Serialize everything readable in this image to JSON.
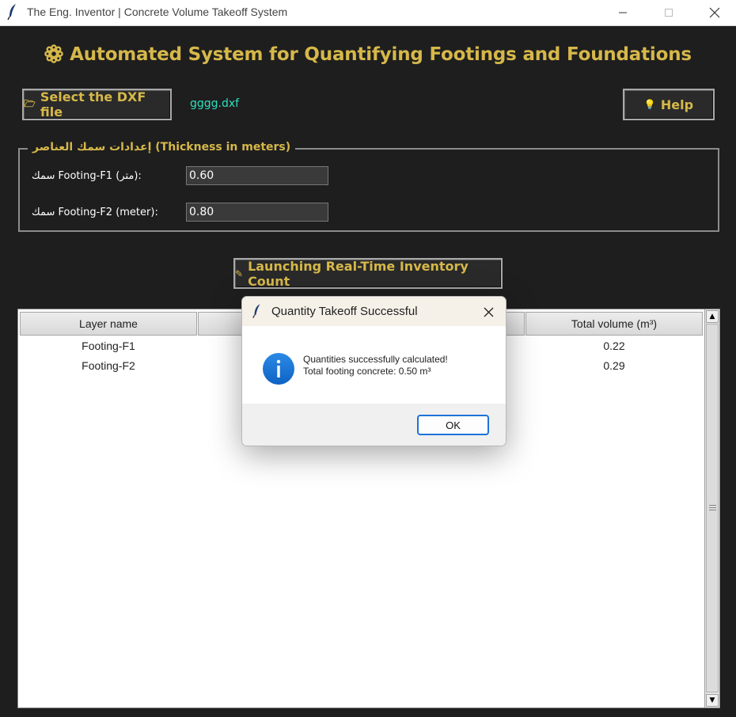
{
  "window": {
    "title": "The Eng. Inventor | Concrete Volume Takeoff System"
  },
  "header": {
    "heading": "Automated System for Quantifying Footings and Foundations",
    "icon": "gear-icon",
    "accent_color": "#d6b84a"
  },
  "toolbar": {
    "select_dxf_label": "Select the DXF file",
    "selected_file": "gggg.dxf",
    "help_label": "Help"
  },
  "thickness": {
    "legend": "إعدادات سمك العناصر (Thickness in meters)",
    "f1_label": "سمك Footing-F1 (متر):",
    "f1_value": "0.60",
    "f2_label": "سمك Footing-F2 (meter):",
    "f2_value": "0.80"
  },
  "launch": {
    "label": "Launching Real-Time Inventory Count"
  },
  "table": {
    "columns": [
      "Layer name",
      "",
      "Total volume (m³)"
    ],
    "rows": [
      {
        "layer": "Footing-F1",
        "volume": "0.22"
      },
      {
        "layer": "Footing-F2",
        "volume": "0.29"
      }
    ]
  },
  "dialog": {
    "title": "Quantity Takeoff Successful",
    "line1": "Quantities successfully calculated!",
    "line2": "Total footing concrete: 0.50 m³",
    "ok_label": "OK"
  }
}
